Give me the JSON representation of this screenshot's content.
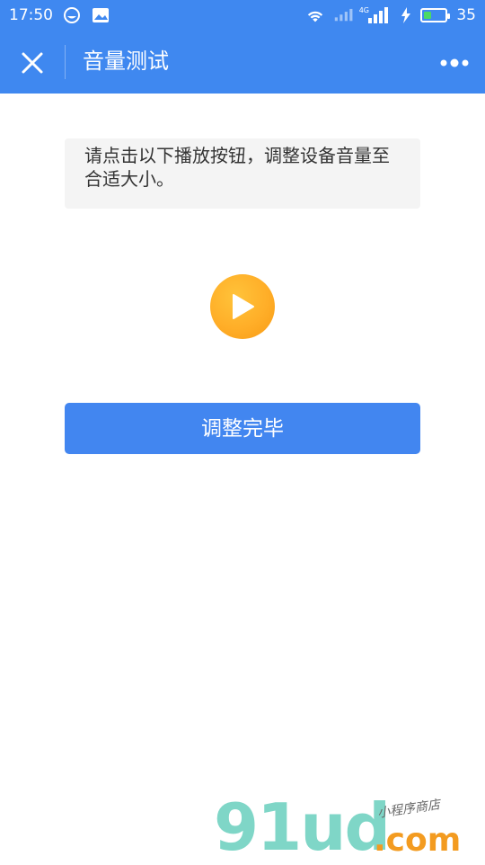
{
  "status_bar": {
    "time": "17:50",
    "battery_level": "35",
    "battery_fraction": 0.35,
    "network_label": "4G"
  },
  "header": {
    "title": "音量测试"
  },
  "instruction": {
    "text": "请点击以下播放按钮，调整设备音量至合适大小。"
  },
  "play_button": {
    "icon": "play-icon",
    "color": "#ffae28"
  },
  "done_button": {
    "label": "调整完毕",
    "color": "#4286f0"
  },
  "watermark": {
    "brand": "91ud",
    "domain": ".com",
    "tagline": "小程序商店"
  },
  "colors": {
    "accent": "#3f88f0"
  }
}
